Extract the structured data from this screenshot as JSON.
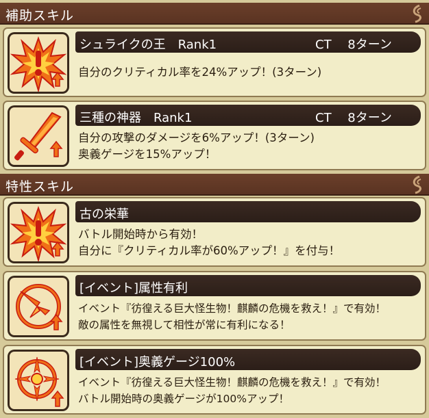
{
  "colors": {
    "header_bg": "#5a3322",
    "card_bg": "#f2edc8",
    "name_bar_bg": "#2b1e18",
    "icon_orange": "#f07018",
    "icon_red": "#c81c10"
  },
  "support_section": {
    "title": "補助スキル",
    "skills": [
      {
        "icon": "burst-exclaim-icon",
        "name": "シュライクの王　Rank1",
        "ct": "CT　 8ターン",
        "desc": [
          "自分のクリティカル率を24%アップ！(3ターン)"
        ]
      },
      {
        "icon": "sword-up-icon",
        "name": "三種の神器　Rank1",
        "ct": "CT　 8ターン",
        "desc": [
          "自分の攻撃のダメージを6%アップ！(3ターン)",
          "奥義ゲージを15%アップ！"
        ]
      }
    ]
  },
  "trait_section": {
    "title": "特性スキル",
    "skills": [
      {
        "icon": "burst-exclaim-icon",
        "name": "古の栄華",
        "desc": [
          "バトル開始時から有効！",
          "自分に『クリティカル率が60%アップ！』を付与！"
        ]
      },
      {
        "icon": "element-advantage-icon",
        "name": "[イベント]属性有利",
        "desc": [
          "イベント『彷徨える巨大怪生物！麒麟の危機を救え！』で有効！",
          "敵の属性を無視して相性が常に有利になる！"
        ]
      },
      {
        "icon": "gauge-up-icon",
        "name": "[イベント]奥義ゲージ100%",
        "desc": [
          "イベント『彷徨える巨大怪生物！麒麟の危機を救え！』で有効！",
          "バトル開始時の奥義ゲージが100%アップ！"
        ]
      }
    ]
  }
}
